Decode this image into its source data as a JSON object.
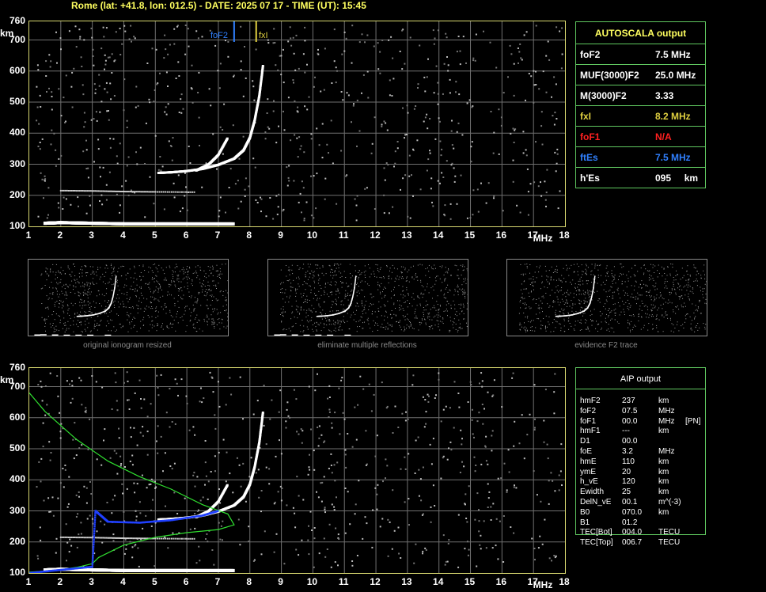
{
  "header": "Rome (lat: +41.8, lon: 012.5) - DATE: 2025 07 17 - TIME (UT): 15:45",
  "axes": {
    "y_unit": "km",
    "x_unit": "MHz",
    "y_ticks": [
      "760",
      "700",
      "600",
      "500",
      "400",
      "300",
      "200",
      "100"
    ],
    "x_ticks": [
      "1",
      "2",
      "3",
      "4",
      "5",
      "6",
      "7",
      "8",
      "9",
      "10",
      "11",
      "12",
      "13",
      "14",
      "15",
      "16",
      "17",
      "18"
    ]
  },
  "markers": {
    "foF2": "foF2",
    "fxI": "fxI"
  },
  "autoscala": {
    "title": "AUTOSCALA output",
    "rows": [
      {
        "label": "foF2",
        "value": "7.5 MHz",
        "color": "#ffffff",
        "vcolor": "#ffffff"
      },
      {
        "label": "MUF(3000)F2",
        "value": "25.0 MHz",
        "color": "#ffffff",
        "vcolor": "#ffffff"
      },
      {
        "label": "M(3000)F2",
        "value": "3.33",
        "color": "#ffffff",
        "vcolor": "#ffffff"
      },
      {
        "label": "fxI",
        "value": "8.2 MHz",
        "color": "#e0d040",
        "vcolor": "#e0d040"
      },
      {
        "label": "foF1",
        "value": "N/A",
        "color": "#ff2020",
        "vcolor": "#ff2020"
      },
      {
        "label": "ftEs",
        "value": "7.5 MHz",
        "color": "#3080ff",
        "vcolor": "#3080ff"
      },
      {
        "label": "h'Es",
        "value": "095     km",
        "color": "#ffffff",
        "vcolor": "#ffffff"
      }
    ]
  },
  "thumbnails": [
    {
      "caption": "original ionogram resized"
    },
    {
      "caption": "eliminate multiple reflections"
    },
    {
      "caption": "evidence F2 trace"
    }
  ],
  "aip": {
    "title": "AIP output",
    "rows": [
      {
        "name": "hmF2",
        "value": "237",
        "unit": "km",
        "extra": ""
      },
      {
        "name": "foF2",
        "value": "07.5",
        "unit": "MHz",
        "extra": ""
      },
      {
        "name": "foF1",
        "value": "00.0",
        "unit": "MHz",
        "extra": "[PN]"
      },
      {
        "name": "hmF1",
        "value": "---",
        "unit": "km",
        "extra": ""
      },
      {
        "name": "D1",
        "value": "00.0",
        "unit": "",
        "extra": ""
      },
      {
        "name": "foE",
        "value": "3.2",
        "unit": "MHz",
        "extra": ""
      },
      {
        "name": "hmE",
        "value": "110",
        "unit": "km",
        "extra": ""
      },
      {
        "name": "ymE",
        "value": "20",
        "unit": "km",
        "extra": ""
      },
      {
        "name": "h_vE",
        "value": "120",
        "unit": "km",
        "extra": ""
      },
      {
        "name": "Ewidth",
        "value": "25",
        "unit": "km",
        "extra": ""
      },
      {
        "name": "DelN_vE",
        "value": "00.1",
        "unit": "m^(-3)",
        "extra": ""
      },
      {
        "name": "B0",
        "value": "070.0",
        "unit": "km",
        "extra": ""
      },
      {
        "name": "B1",
        "value": "01.2",
        "unit": "",
        "extra": ""
      },
      {
        "name": "TEC[Bot]",
        "value": "004.0",
        "unit": "TECU",
        "extra": ""
      },
      {
        "name": "TEC[Top]",
        "value": "006.7",
        "unit": "TECU",
        "extra": ""
      }
    ]
  },
  "chart_data": [
    {
      "type": "scatter",
      "name_hint": "ionogram",
      "xlim": [
        1,
        18
      ],
      "ylim": [
        100,
        760
      ],
      "grid": true,
      "traces": {
        "F2": [
          [
            5.1,
            272
          ],
          [
            5.5,
            274
          ],
          [
            6.0,
            278
          ],
          [
            6.5,
            285
          ],
          [
            7.0,
            298
          ],
          [
            7.5,
            318
          ],
          [
            7.8,
            345
          ],
          [
            8.0,
            385
          ],
          [
            8.15,
            440
          ],
          [
            8.3,
            520
          ],
          [
            8.42,
            620
          ]
        ],
        "F2_second": [
          [
            6.3,
            280
          ],
          [
            6.7,
            300
          ],
          [
            7.0,
            330
          ],
          [
            7.3,
            385
          ]
        ],
        "E": [
          [
            1.5,
            110
          ],
          [
            2.0,
            112
          ],
          [
            3.0,
            110
          ],
          [
            4.0,
            108
          ],
          [
            5.0,
            108
          ],
          [
            6.0,
            108
          ],
          [
            7.5,
            108
          ]
        ],
        "Es_faint": [
          [
            2.0,
            215
          ],
          [
            3.0,
            214
          ],
          [
            4.0,
            212
          ],
          [
            5.0,
            211
          ],
          [
            6.3,
            210
          ]
        ]
      },
      "foF2": 7.5,
      "fxI": 8.2
    },
    {
      "type": "line",
      "name_hint": "aip",
      "xlim": [
        1,
        18
      ],
      "ylim": [
        100,
        760
      ],
      "grid": true,
      "profile_green": [
        [
          1.0,
          680
        ],
        [
          1.5,
          620
        ],
        [
          2.5,
          530
        ],
        [
          3.5,
          460
        ],
        [
          4.5,
          410
        ],
        [
          5.5,
          370
        ],
        [
          6.5,
          320
        ],
        [
          7.3,
          290
        ],
        [
          7.5,
          255
        ],
        [
          7.0,
          240
        ],
        [
          6.0,
          230
        ],
        [
          5.0,
          215
        ],
        [
          4.0,
          190
        ],
        [
          3.2,
          150
        ],
        [
          3.0,
          130
        ],
        [
          2.5,
          118
        ],
        [
          1.8,
          108
        ],
        [
          1.0,
          103
        ]
      ],
      "profile_blue": [
        [
          1.0,
          100
        ],
        [
          2.0,
          110
        ],
        [
          3.0,
          120
        ],
        [
          3.1,
          300
        ],
        [
          3.5,
          265
        ],
        [
          4.5,
          262
        ],
        [
          5.5,
          270
        ],
        [
          6.5,
          285
        ],
        [
          7.0,
          300
        ]
      ]
    }
  ]
}
